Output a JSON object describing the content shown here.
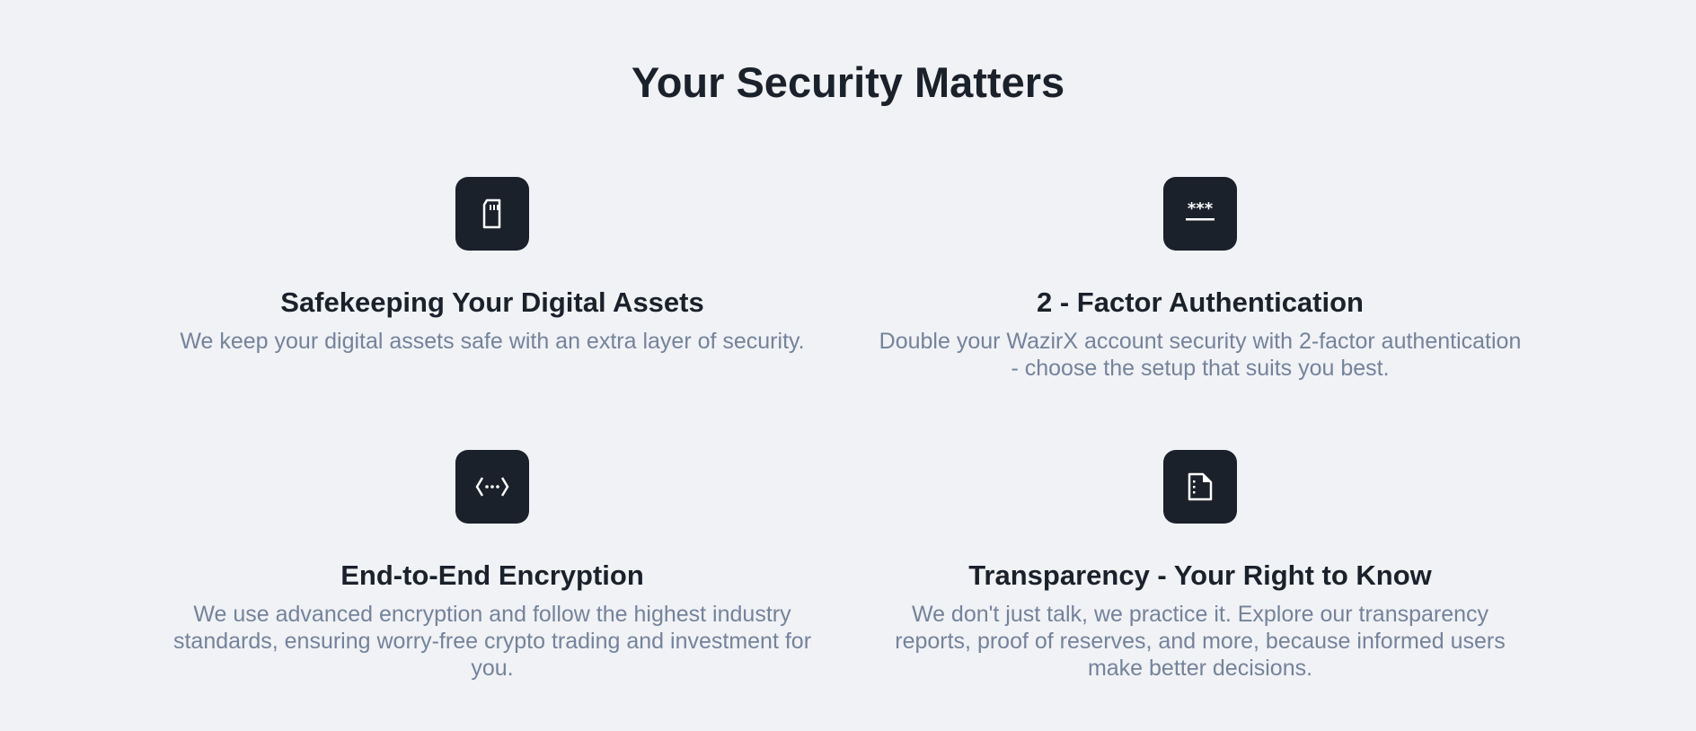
{
  "title": "Your Security Matters",
  "features": [
    {
      "icon": "sd-card-icon",
      "title": "Safekeeping Your Digital Assets",
      "description": "We keep your digital assets safe with an extra layer of security."
    },
    {
      "icon": "password-icon",
      "title": "2 - Factor Authentication",
      "description": "Double your WazirX account security with 2-factor authentication - choose the setup that suits you best."
    },
    {
      "icon": "code-encryption-icon",
      "title": "End-to-End Encryption",
      "description": "We use advanced encryption and follow the highest industry standards, ensuring worry-free crypto trading and investment for you."
    },
    {
      "icon": "document-icon",
      "title": "Transparency - Your Right to Know",
      "description": "We don't just talk, we practice it. Explore our transparency reports, proof of reserves, and more, because informed users make better decisions."
    }
  ]
}
